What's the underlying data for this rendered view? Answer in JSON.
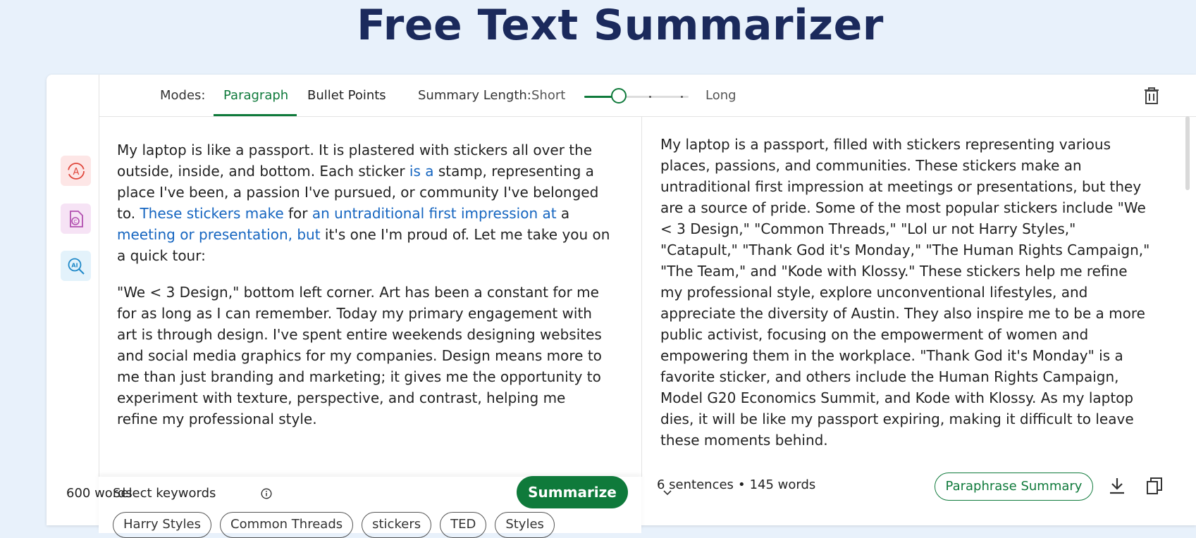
{
  "page": {
    "title": "Free Text Summarizer"
  },
  "toolbar": {
    "modes_label": "Modes:",
    "tabs": [
      "Paragraph",
      "Bullet Points"
    ],
    "active_tab": "Paragraph",
    "length_label": "Summary Length:",
    "length_short": "Short",
    "length_long": "Long",
    "length_value": 0.33
  },
  "input": {
    "paragraph1": [
      {
        "t": "My laptop is like a passport. It is plastered with stickers all over the outside, inside, and bottom. Each sticker ",
        "h": false
      },
      {
        "t": "is a",
        "h": true
      },
      {
        "t": " stamp, representing a place I've been, a passion I've pursued, or community I've belonged to. ",
        "h": false
      },
      {
        "t": "These stickers make",
        "h": true
      },
      {
        "t": " for ",
        "h": false
      },
      {
        "t": "an untraditional first impression at",
        "h": true
      },
      {
        "t": " a ",
        "h": false
      },
      {
        "t": "meeting or presentation, but",
        "h": true
      },
      {
        "t": " it's one I'm proud of. Let me take you on a quick tour:",
        "h": false
      }
    ],
    "paragraph2": "\"We < 3 Design,\" bottom left corner. Art has been a constant for me for as long as I can remember. Today my primary engagement with art is through design. I've spent entire weekends designing websites and social media graphics for my companies. Design means more to me than just branding and marketing; it gives me the opportunity to experiment with texture, perspective, and contrast, helping me refine my professional style."
  },
  "keywords": {
    "title": "Select keywords",
    "items": [
      "Harry Styles",
      "Common Threads",
      "stickers",
      "TED",
      "Styles"
    ]
  },
  "footer_left": {
    "word_count": "600 words",
    "summarize": "Summarize"
  },
  "output": {
    "summary": "My laptop is a passport, filled with stickers representing various places, passions, and communities. These stickers make an untraditional first impression at meetings or presentations, but they are a source of pride. Some of the most popular stickers include \"We < 3 Design,\" \"Common Threads,\" \"Lol ur not Harry Styles,\" \"Catapult,\" \"Thank God it's Monday,\" \"The Human Rights Campaign,\" \"The Team,\" and \"Kode with Klossy.\" These stickers help me refine my professional style, explore unconventional lifestyles, and appreciate the diversity of Austin. They also inspire me to be a more public activist, focusing on the empowerment of women and empowering them in the workplace. \"Thank God it's Monday\" is a favorite sticker, and others include the Human Rights Campaign, Model G20 Economics Summit, and Kode with Klossy. As my laptop dies, it will be like my passport expiring, making it difficult to leave these moments behind.",
    "sentences": "6 sentences",
    "words": "145 words",
    "paraphrase_label": "Paraphrase Summary"
  },
  "icons": {
    "rail": [
      "paraphraser-icon",
      "plagiarism-checker-icon",
      "ai-detector-icon"
    ],
    "toolbar": [
      "trash-icon"
    ],
    "output": [
      "download-icon",
      "copy-icon"
    ]
  },
  "colors": {
    "accent": "#0f7a3b",
    "highlight": "#1565c0",
    "title": "#1b2a5c",
    "background": "#e8f1fb"
  }
}
